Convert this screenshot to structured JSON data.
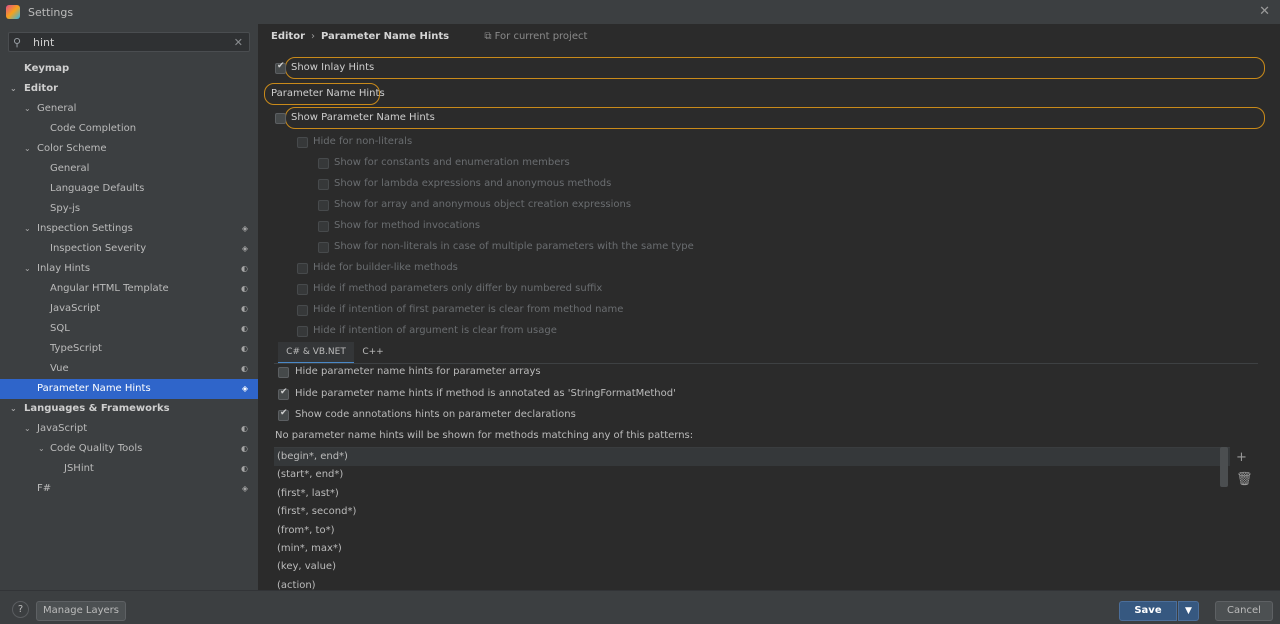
{
  "window": {
    "title": "Settings"
  },
  "search": {
    "value": "hint"
  },
  "tree": [
    {
      "label": "Keymap",
      "bold": true,
      "level": 0,
      "arrow": "",
      "badge": ""
    },
    {
      "label": "Editor",
      "bold": true,
      "level": 0,
      "arrow": "⌄",
      "badge": ""
    },
    {
      "label": "General",
      "bold": false,
      "level": 1,
      "arrow": "⌄",
      "badge": ""
    },
    {
      "label": "Code Completion",
      "bold": false,
      "level": 2,
      "arrow": "",
      "badge": ""
    },
    {
      "label": "Color Scheme",
      "bold": false,
      "level": 1,
      "arrow": "⌄",
      "badge": ""
    },
    {
      "label": "General",
      "bold": false,
      "level": 2,
      "arrow": "",
      "badge": ""
    },
    {
      "label": "Language Defaults",
      "bold": false,
      "level": 2,
      "arrow": "",
      "badge": ""
    },
    {
      "label": "Spy-js",
      "bold": false,
      "level": 2,
      "arrow": "",
      "badge": ""
    },
    {
      "label": "Inspection Settings",
      "bold": false,
      "level": 1,
      "arrow": "⌄",
      "badge": "layers"
    },
    {
      "label": "Inspection Severity",
      "bold": false,
      "level": 2,
      "arrow": "",
      "badge": "layers"
    },
    {
      "label": "Inlay Hints",
      "bold": false,
      "level": 1,
      "arrow": "⌄",
      "badge": "half"
    },
    {
      "label": "Angular HTML Template",
      "bold": false,
      "level": 2,
      "arrow": "",
      "badge": "half"
    },
    {
      "label": "JavaScript",
      "bold": false,
      "level": 2,
      "arrow": "",
      "badge": "half"
    },
    {
      "label": "SQL",
      "bold": false,
      "level": 2,
      "arrow": "",
      "badge": "half"
    },
    {
      "label": "TypeScript",
      "bold": false,
      "level": 2,
      "arrow": "",
      "badge": "half"
    },
    {
      "label": "Vue",
      "bold": false,
      "level": 2,
      "arrow": "",
      "badge": "half"
    },
    {
      "label": "Parameter Name Hints",
      "bold": false,
      "level": 1,
      "arrow": "",
      "badge": "layers",
      "selected": true
    },
    {
      "label": "Languages & Frameworks",
      "bold": true,
      "level": 0,
      "arrow": "⌄",
      "badge": ""
    },
    {
      "label": "JavaScript",
      "bold": false,
      "level": 1,
      "arrow": "⌄",
      "badge": "half"
    },
    {
      "label": "Code Quality Tools",
      "bold": false,
      "level": 2,
      "arrow": "⌄",
      "badge": "half"
    },
    {
      "label": "JSHint",
      "bold": false,
      "level": 3,
      "arrow": "",
      "badge": "half"
    },
    {
      "label": "F#",
      "bold": false,
      "level": 1,
      "arrow": "",
      "badge": "layers"
    }
  ],
  "breadcrumb": {
    "section": "Editor",
    "page": "Parameter Name Hints",
    "scope": "For current project"
  },
  "options": {
    "show_inlay_hints": "Show Inlay Hints",
    "group_title": "Parameter Name Hints",
    "show_param_hints": "Show Parameter Name Hints",
    "disabled": [
      {
        "label": "Hide for non-literals",
        "level": 0
      },
      {
        "label": "Show for constants and enumeration members",
        "level": 1
      },
      {
        "label": "Show for lambda expressions and anonymous methods",
        "level": 1
      },
      {
        "label": "Show for array and anonymous object creation expressions",
        "level": 1
      },
      {
        "label": "Show for method invocations",
        "level": 1
      },
      {
        "label": "Show for non-literals in case of multiple parameters with the same type",
        "level": 1
      },
      {
        "label": "Hide for builder-like methods",
        "level": 0
      },
      {
        "label": "Hide if method parameters only differ by numbered suffix",
        "level": 0
      },
      {
        "label": "Hide if intention of first parameter is clear from method name",
        "level": 0
      },
      {
        "label": "Hide if intention of argument is clear from usage",
        "level": 0
      }
    ]
  },
  "tabs": [
    {
      "label": "C# & VB.NET",
      "active": true
    },
    {
      "label": "C++",
      "active": false
    }
  ],
  "csharp": {
    "hide_arrays": "Hide parameter name hints for parameter arrays",
    "hide_stringformat": "Hide parameter name hints if method is annotated as 'StringFormatMethod'",
    "show_annotations": "Show code annotations hints on parameter declarations",
    "patterns_label": "No parameter name hints will be shown for methods matching any of this patterns:",
    "patterns": [
      "(begin*, end*)",
      "(start*, end*)",
      "(first*, last*)",
      "(first*, second*)",
      "(from*, to*)",
      "(min*, max*)",
      "(key, value)",
      "(action)"
    ]
  },
  "footer": {
    "help": "?",
    "manage_layers": "Manage Layers",
    "save": "Save",
    "cancel": "Cancel"
  }
}
